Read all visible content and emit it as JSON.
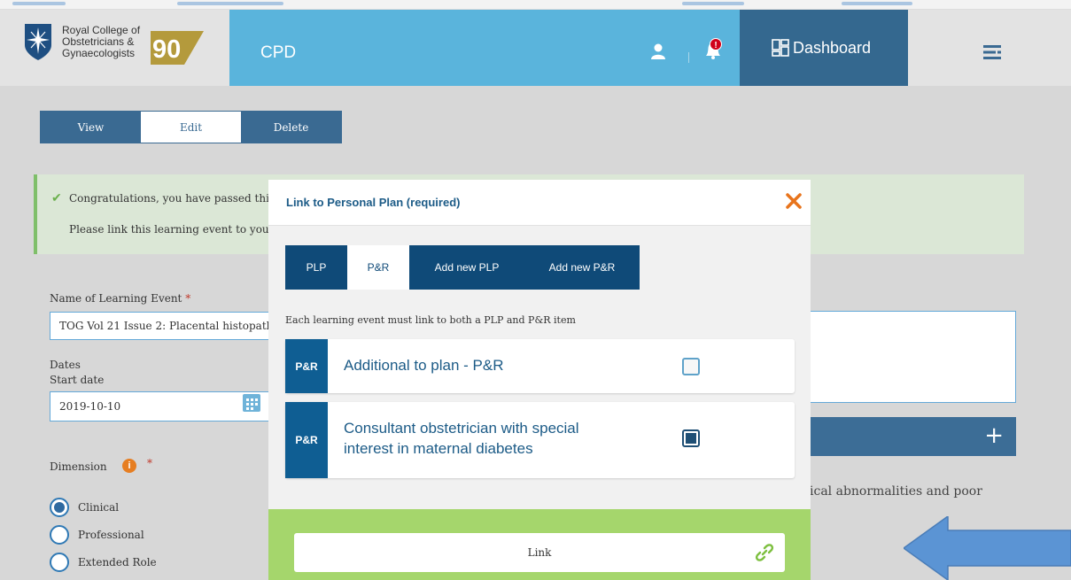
{
  "header": {
    "org_name_lines": [
      "Royal College of",
      "Obstetricians &",
      "Gynaecologists"
    ],
    "anniversary": "90",
    "section_title": "CPD",
    "notification_count": "!",
    "dashboard_label": "Dashboard"
  },
  "toolbar": {
    "view_label": "View",
    "edit_label": "Edit",
    "delete_label": "Delete"
  },
  "alert": {
    "line1": "Congratulations, you have passed thi",
    "line2": "Please link this learning event to you"
  },
  "form": {
    "name_label": "Name of Learning Event",
    "required_mark": "*",
    "name_value": "TOG Vol 21 Issue 2: Placental histopatl",
    "dates_label": "Dates",
    "start_date_label": "Start date",
    "start_date_value": "2019-10-10",
    "dimension_label": "Dimension",
    "info_glyph": "i",
    "dimension_options": [
      "Clinical",
      "Professional",
      "Extended Role"
    ],
    "partial_text": "ical abnormalities and poor",
    "add_label": "+"
  },
  "modal": {
    "title": "Link to Personal Plan (required)",
    "tabs": [
      "PLP",
      "P&R",
      "Add new PLP",
      "Add new P&R"
    ],
    "active_tab": "P&R",
    "instruction": "Each learning event must link to both a PLP and P&R item",
    "items": [
      {
        "tag": "P&R",
        "title_lines": [
          "Additional to plan - P&R"
        ],
        "checked": false
      },
      {
        "tag": "P&R",
        "title_lines": [
          "Consultant obstetrician with special",
          "interest in maternal diabetes"
        ],
        "checked": true
      }
    ],
    "link_label": "Link"
  },
  "colors": {
    "header_blue": "#5ab4dc",
    "dashboard_blue": "#34688f",
    "modal_navy": "#0f4a78",
    "footer_green": "#a5d66c",
    "close_orange": "#e8741c",
    "notification_red": "#d0021b"
  }
}
